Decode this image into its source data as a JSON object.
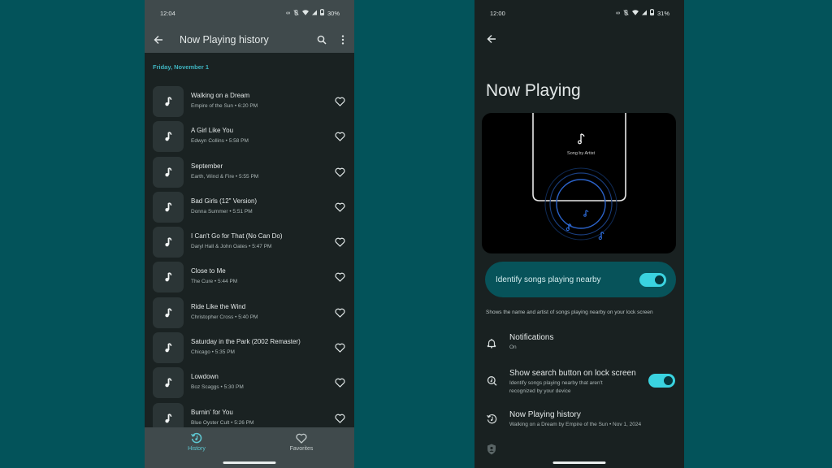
{
  "left_phone": {
    "status": {
      "time": "12:04",
      "battery": "30%"
    },
    "appbar": {
      "title": "Now Playing history",
      "back_icon": "arrow-back-icon",
      "search_icon": "search-icon",
      "more_icon": "more-vert-icon"
    },
    "date_header": "Friday, November 1",
    "songs": [
      {
        "title": "Walking on a Dream",
        "artist": "Empire of the Sun",
        "time": "6:20 PM",
        "subtitle": "Empire of the Sun • 6:20 PM"
      },
      {
        "title": "A Girl Like You",
        "artist": "Edwyn Collins",
        "time": "5:58 PM",
        "subtitle": "Edwyn Collins • 5:58 PM"
      },
      {
        "title": "September",
        "artist": "Earth, Wind & Fire",
        "time": "5:55 PM",
        "subtitle": "Earth, Wind & Fire • 5:55 PM"
      },
      {
        "title": "Bad Girls (12\" Version)",
        "artist": "Donna Summer",
        "time": "5:51 PM",
        "subtitle": "Donna Summer • 5:51 PM"
      },
      {
        "title": "I Can't Go for That (No Can Do)",
        "artist": "Daryl Hall & John Oates",
        "time": "5:47 PM",
        "subtitle": "Daryl Hall & John Oates • 5:47 PM"
      },
      {
        "title": "Close to Me",
        "artist": "The Cure",
        "time": "5:44 PM",
        "subtitle": "The Cure • 5:44 PM"
      },
      {
        "title": "Ride Like the Wind",
        "artist": "Christopher Cross",
        "time": "5:40 PM",
        "subtitle": "Christopher Cross • 5:40 PM"
      },
      {
        "title": "Saturday in the Park (2002 Remaster)",
        "artist": "Chicago",
        "time": "5:35 PM",
        "subtitle": "Chicago • 5:35 PM"
      },
      {
        "title": "Lowdown",
        "artist": "Boz Scaggs",
        "time": "5:30 PM",
        "subtitle": "Boz Scaggs • 5:30 PM"
      },
      {
        "title": "Burnin' for You",
        "artist": "Blue Oyster Cult",
        "time": "5:26 PM",
        "subtitle": "Blue Oyster Cult • 5:26 PM"
      }
    ],
    "bottom_nav": [
      {
        "label": "History",
        "icon": "history-icon",
        "selected": true
      },
      {
        "label": "Favorites",
        "icon": "heart-icon",
        "selected": false
      }
    ]
  },
  "right_phone": {
    "status": {
      "time": "12:00",
      "battery": "31%"
    },
    "title": "Now Playing",
    "illustration": {
      "caption": "Song by Artist"
    },
    "identify_toggle": {
      "label": "Identify songs playing nearby",
      "on": true
    },
    "description": "Shows the name and artist of songs playing nearby on your lock screen",
    "settings": {
      "notifications": {
        "title": "Notifications",
        "subtitle": "On",
        "icon": "bell-icon"
      },
      "search_button": {
        "title": "Show search button on lock screen",
        "subtitle_line1": "Identify songs playing nearby that aren't",
        "subtitle_line2": "recognized by your device",
        "on": true,
        "icon": "music-search-icon"
      },
      "history": {
        "title": "Now Playing history",
        "subtitle": "Walking on a Dream by Empire of the Sun • Nov 1, 2024",
        "icon": "history-icon"
      },
      "privacy": {
        "icon": "shield-person-icon"
      }
    }
  },
  "colors": {
    "background": "#03535a",
    "accent": "#3ad3e0",
    "date_header": "#3fb3bf",
    "card": "#07535a"
  }
}
